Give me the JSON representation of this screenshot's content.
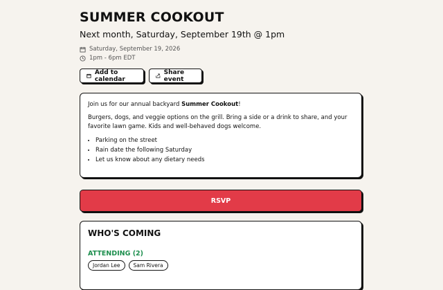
{
  "event": {
    "title": "SUMMER COOKOUT",
    "subtitle": "Next month, Saturday, September 19th @ 1pm",
    "date": "Saturday, September 19, 2026",
    "time": "1pm - 6pm EDT"
  },
  "actions": {
    "add_calendar": "Add to calendar",
    "share": "Share event"
  },
  "description": {
    "intro_prefix": "Join us for our annual backyard ",
    "intro_bold": "Summer Cookout",
    "intro_suffix": "!",
    "body": "Burgers, dogs, and veggie options on the grill. Bring a side or a drink to share, and your favorite lawn game. Kids and well-behaved dogs welcome.",
    "bullets": [
      "Parking on the street",
      "Rain date the following Saturday",
      "Let us know about any dietary needs"
    ]
  },
  "rsvp_label": "RSVP",
  "guests": {
    "title": "WHO'S COMING",
    "attending_label": "ATTENDING (2)",
    "attending": [
      "Jordan Lee",
      "Sam Rivera"
    ]
  },
  "colors": {
    "background": "#f6f3ee",
    "rsvp": "#e23b48",
    "attending": "#1d8f4e"
  },
  "icons": {
    "date": "calendar-icon",
    "time": "clock-icon",
    "add": "calendar-icon",
    "share": "share-icon"
  }
}
